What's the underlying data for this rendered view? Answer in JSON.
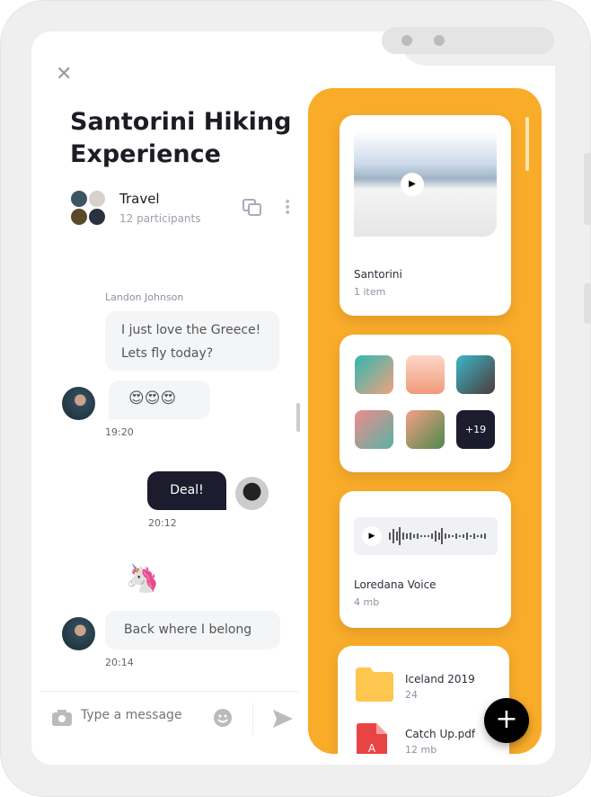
{
  "chat": {
    "title": "Santorini Hiking Experience",
    "group": {
      "name": "Travel",
      "participants": "12 participants"
    },
    "messages": [
      {
        "sender": "Landon Johnson",
        "lines": [
          "I just love the Greece!",
          "Lets fly today?"
        ]
      },
      {
        "text": "😍😍😍",
        "time": "19:20"
      },
      {
        "text": "Deal!",
        "time": "20:12"
      },
      {
        "text": "🦄"
      },
      {
        "text": "Back where I belong",
        "time": "20:14"
      }
    ],
    "input": {
      "placeholder": "Type a message"
    }
  },
  "media": {
    "album": {
      "name": "Santorini",
      "count": "1 item"
    },
    "gallery": {
      "more": "+19"
    },
    "voice": {
      "name": "Loredana Voice",
      "size": "4 mb"
    },
    "files": [
      {
        "name": "Iceland 2019",
        "meta": "24"
      },
      {
        "name": "Catch Up.pdf",
        "meta": "12 mb"
      }
    ]
  },
  "colors": {
    "accent": "#f9ac2a",
    "dark_bubble": "#1c1c2e"
  },
  "icons": {
    "close": "close-icon",
    "copy": "copy-icon",
    "more": "more-vertical-icon",
    "camera": "camera-icon",
    "emoji": "emoji-icon",
    "send": "send-icon",
    "add": "plus-icon",
    "play": "play-icon"
  }
}
